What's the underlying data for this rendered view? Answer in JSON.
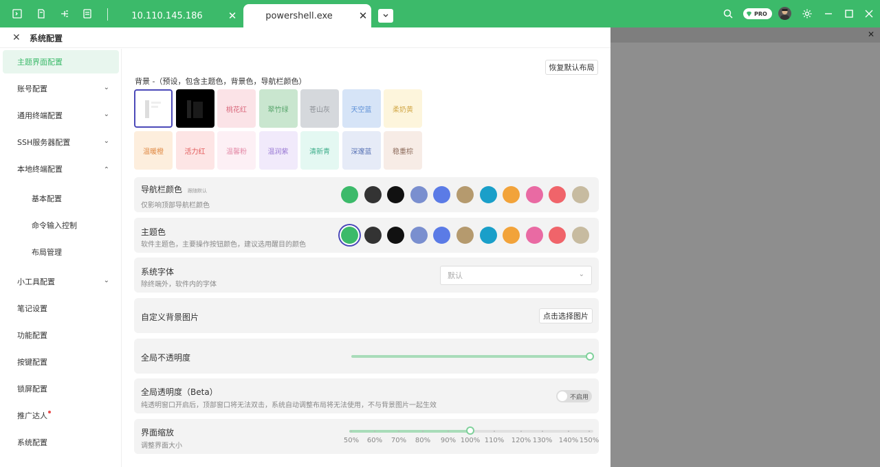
{
  "topbar": {
    "tabs": [
      {
        "title": "10.110.145.186",
        "close": "✕"
      },
      {
        "title": "powershell.exe",
        "close": "✕"
      }
    ],
    "pro_label": "PRO"
  },
  "panel": {
    "title": "系统配置",
    "close": "✕"
  },
  "sidebar": {
    "items": [
      {
        "label": "主题界面配置"
      },
      {
        "label": "账号配置"
      },
      {
        "label": "通用终端配置"
      },
      {
        "label": "SSH服务器配置"
      },
      {
        "label": "本地终端配置"
      },
      {
        "label": "基本配置"
      },
      {
        "label": "命令输入控制"
      },
      {
        "label": "布局管理"
      },
      {
        "label": "小工具配置"
      },
      {
        "label": "笔记设置"
      },
      {
        "label": "功能配置"
      },
      {
        "label": "按键配置"
      },
      {
        "label": "锁屏配置"
      },
      {
        "label": "推广达人"
      },
      {
        "label": "系统配置"
      }
    ]
  },
  "content": {
    "restore_button": "恢复默认布局",
    "background_label": "背景 -（预设，包含主题色，背景色，导航栏颜色）",
    "bg_presets": [
      {
        "label": "",
        "bg": "#ffffff"
      },
      {
        "label": "",
        "bg": "#000000"
      },
      {
        "label": "桃花红",
        "bg": "#fbe3e7",
        "fg": "#d9667a"
      },
      {
        "label": "翠竹绿",
        "bg": "#c9e6cf",
        "fg": "#56a46a"
      },
      {
        "label": "苍山灰",
        "bg": "#d5d8dc",
        "fg": "#8a8e94"
      },
      {
        "label": "天空蓝",
        "bg": "#d6e4f7",
        "fg": "#5c8fd6"
      },
      {
        "label": "柔奶黄",
        "bg": "#fdf5dc",
        "fg": "#d2a94a"
      },
      {
        "label": "温暖橙",
        "bg": "#fdeedd",
        "fg": "#e08a45"
      },
      {
        "label": "活力红",
        "bg": "#fde5e5",
        "fg": "#e25757"
      },
      {
        "label": "温馨粉",
        "bg": "#fdf0f5",
        "fg": "#e48aa7"
      },
      {
        "label": "温润紫",
        "bg": "#f1eafb",
        "fg": "#9a7ad4"
      },
      {
        "label": "清新青",
        "bg": "#e4f8f2",
        "fg": "#3fae8b"
      },
      {
        "label": "深邃蓝",
        "bg": "#e6ebf7",
        "fg": "#5570b4"
      },
      {
        "label": "稳重棕",
        "bg": "#f7ece6",
        "fg": "#8c6a5a"
      }
    ],
    "nav_color": {
      "title": "导航栏颜色",
      "note": "跟随默认",
      "desc": "仅影响顶部导航栏颜色",
      "colors": [
        "#3cba6a",
        "#333333",
        "#111111",
        "#7a8fcf",
        "#5b7be6",
        "#b59a6e",
        "#1a9fc9",
        "#f2a33a",
        "#e96aa3",
        "#f0646a",
        "#c7bba0"
      ]
    },
    "theme_color": {
      "title": "主题色",
      "desc": "软件主题色，主要操作按钮颜色，建议选用醒目的颜色",
      "colors": [
        "#3cba6a",
        "#333333",
        "#111111",
        "#7a8fcf",
        "#5b7be6",
        "#b59a6e",
        "#1a9fc9",
        "#f2a33a",
        "#e96aa3",
        "#f0646a",
        "#c7bba0"
      ]
    },
    "system_font": {
      "title": "系统字体",
      "desc": "除终端外，软件内的字体",
      "value": "默认"
    },
    "custom_bg": {
      "title": "自定义背景图片",
      "button": "点击选择图片"
    },
    "global_opacity": {
      "title": "全局不透明度",
      "value": 1.0
    },
    "global_transparency": {
      "title": "全局透明度（Beta）",
      "desc": "纯透明窗口开启后，顶部窗口将无法双击，系统自动调整布局将无法使用，不与背景图片一起生效",
      "toggle_label": "不启用"
    },
    "ui_zoom": {
      "title": "界面缩放",
      "desc": "调整界面大小",
      "labels": [
        "50%",
        "60%",
        "70%",
        "80%",
        "90%",
        "100%",
        "110%",
        "120%",
        "130%",
        "140%",
        "150%"
      ],
      "value": "100%"
    }
  }
}
